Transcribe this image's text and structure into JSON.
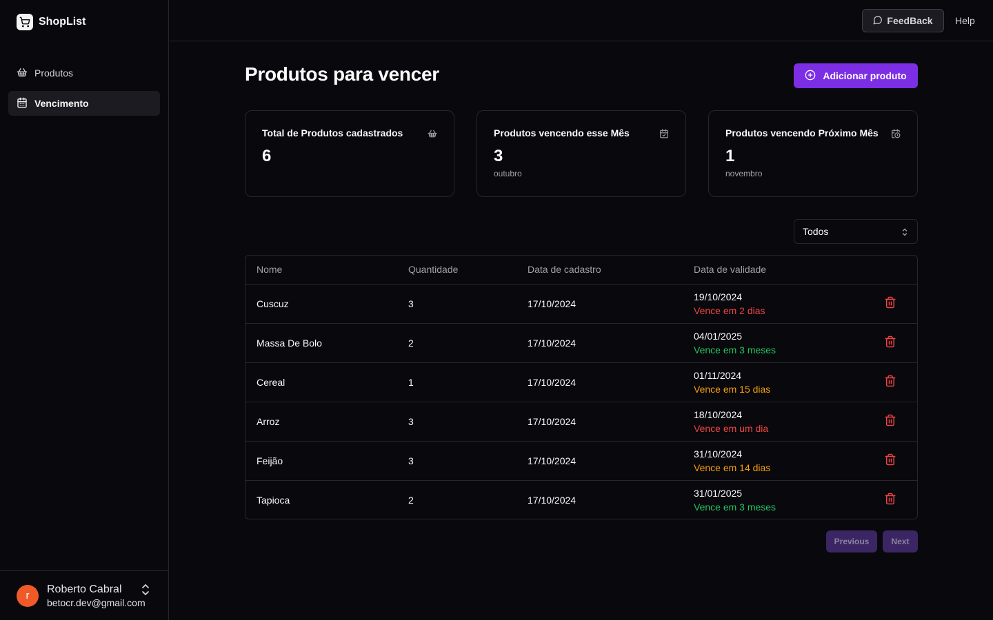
{
  "app": {
    "name": "ShopList"
  },
  "sidebar": {
    "items": [
      {
        "label": "Produtos",
        "icon": "basket-icon",
        "active": false
      },
      {
        "label": "Vencimento",
        "icon": "calendar-icon",
        "active": true
      }
    ]
  },
  "user": {
    "initial": "r",
    "name": "Roberto Cabral",
    "email": "betocr.dev@gmail.com"
  },
  "topbar": {
    "feedback": "FeedBack",
    "help": "Help"
  },
  "page": {
    "title": "Produtos para vencer",
    "add_button": "Adicionar produto"
  },
  "cards": [
    {
      "title": "Total de Produtos cadastrados",
      "value": "6",
      "sub": "",
      "icon": "basket-icon"
    },
    {
      "title": "Produtos vencendo esse Mês",
      "value": "3",
      "sub": "outubro",
      "icon": "calendar-check-icon"
    },
    {
      "title": "Produtos vencendo Próximo Mês",
      "value": "1",
      "sub": "novembro",
      "icon": "calendar-clock-icon"
    }
  ],
  "filter": {
    "selected": "Todos"
  },
  "table": {
    "headers": [
      "Nome",
      "Quantidade",
      "Data de cadastro",
      "Data de validade"
    ],
    "rows": [
      {
        "nome": "Cuscuz",
        "quantidade": "3",
        "cadastro": "17/10/2024",
        "validade": "19/10/2024",
        "vence": "Vence em 2 dias",
        "status": "red"
      },
      {
        "nome": "Massa De Bolo",
        "quantidade": "2",
        "cadastro": "17/10/2024",
        "validade": "04/01/2025",
        "vence": "Vence em 3 meses",
        "status": "green"
      },
      {
        "nome": "Cereal",
        "quantidade": "1",
        "cadastro": "17/10/2024",
        "validade": "01/11/2024",
        "vence": "Vence em 15 dias",
        "status": "orange"
      },
      {
        "nome": "Arroz",
        "quantidade": "3",
        "cadastro": "17/10/2024",
        "validade": "18/10/2024",
        "vence": "Vence em um dia",
        "status": "red"
      },
      {
        "nome": "Feijão",
        "quantidade": "3",
        "cadastro": "17/10/2024",
        "validade": "31/10/2024",
        "vence": "Vence em 14 dias",
        "status": "orange"
      },
      {
        "nome": "Tapioca",
        "quantidade": "2",
        "cadastro": "17/10/2024",
        "validade": "31/01/2025",
        "vence": "Vence em 3 meses",
        "status": "green"
      }
    ]
  },
  "pagination": {
    "previous": "Previous",
    "next": "Next"
  },
  "colors": {
    "accent": "#7c2ee5",
    "status_red": "#ef4444",
    "status_orange": "#f59e0b",
    "status_green": "#22c55e",
    "avatar": "#f05a28"
  }
}
